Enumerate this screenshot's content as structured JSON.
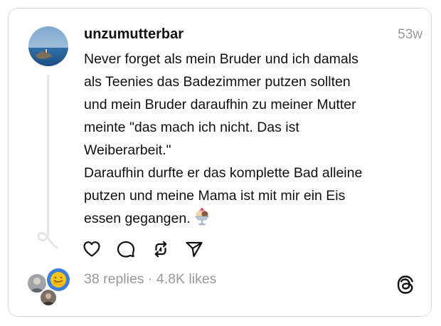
{
  "post": {
    "username": "unzumutterbar",
    "time": "53w",
    "text": "Never forget als mein Bruder und ich damals\nals Teenies das Badezimmer putzen sollten\nund mein Bruder daraufhin zu meiner Mutter\nmeinte \"das mach ich nicht. Das ist\nWeiberarbeit.\"\nDaraufhin durfte er das komplette Bad alleine\nputzen und meine Mama ist mit mir ein Eis\nessen gegangen.",
    "emoji": "ice-cream-sundae-emoji"
  },
  "actions": [
    {
      "name": "like",
      "icon": "heart-icon"
    },
    {
      "name": "reply",
      "icon": "speech-bubble-icon"
    },
    {
      "name": "repost",
      "icon": "repost-icon"
    },
    {
      "name": "share",
      "icon": "send-icon"
    }
  ],
  "stats": "38 replies · 4.8K likes",
  "colors": {
    "text": "#101010",
    "muted": "#999999",
    "border": "#d9d9d9",
    "thread_line": "#e6e6e6"
  }
}
